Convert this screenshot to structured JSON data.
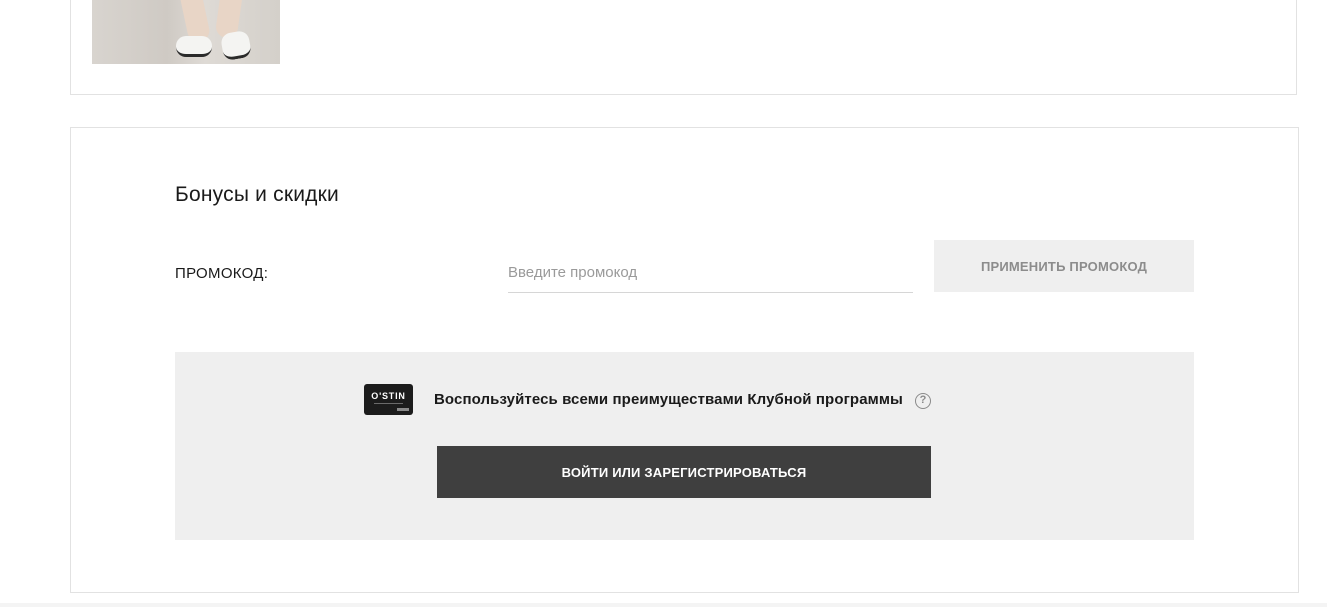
{
  "bonus": {
    "title": "Бонусы и скидки",
    "promo_label": "ПРОМОКОД:",
    "promo_placeholder": "Введите промокод",
    "promo_value": "",
    "apply_label": "ПРИМЕНИТЬ ПРОМОКОД"
  },
  "club": {
    "card_brand": "O'STIN",
    "text": "Воспользуйтесь всеми преимуществами Клубной программы",
    "help_icon": "question-circle-icon",
    "login_label": "ВОЙТИ ИЛИ ЗАРЕГИСТРИРОВАТЬСЯ"
  },
  "colors": {
    "club_background": "#efefef",
    "login_button": "#3f3f3f",
    "apply_button": "#efefef",
    "apply_text": "#8c8c8c"
  }
}
